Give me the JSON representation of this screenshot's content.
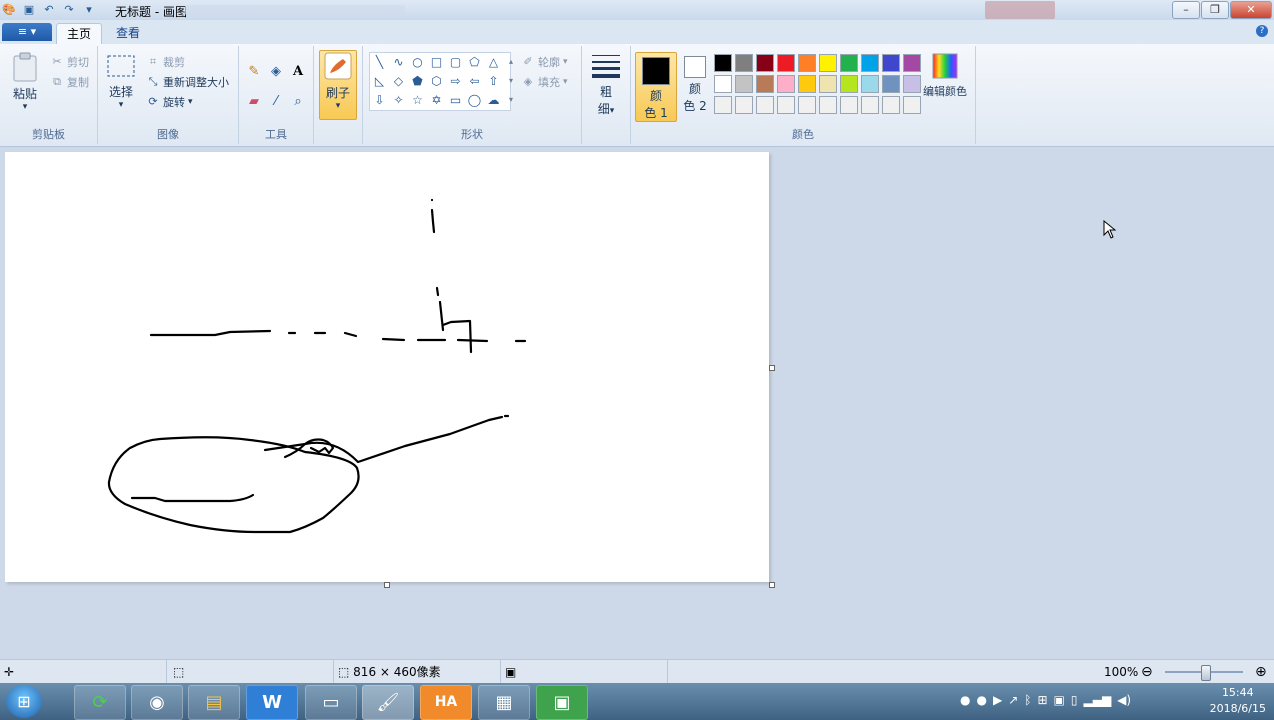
{
  "window": {
    "title": "无标题 - 画图",
    "min": "–",
    "max": "❐",
    "close": "✕"
  },
  "tabs": [
    {
      "label": "主页"
    },
    {
      "label": "查看"
    }
  ],
  "app_menu": "≡ ▾",
  "help": "?",
  "ribbon": {
    "clipboard": {
      "paste": "粘贴",
      "cut": "剪切",
      "copy": "复制",
      "label": "剪贴板"
    },
    "image": {
      "select": "选择",
      "crop": "裁剪",
      "resize": "重新调整大小",
      "rotate": "旋转",
      "label": "图像"
    },
    "tools": {
      "label": "工具",
      "text_tool": "A"
    },
    "brush": {
      "label": "刷子"
    },
    "shapes": {
      "outline": "轮廓",
      "fill": "填充",
      "label": "形状"
    },
    "size": {
      "label_line1": "粗",
      "label_line2": "细"
    },
    "colors": {
      "color1_a": "颜",
      "color1_b": "色 1",
      "color2_a": "颜",
      "color2_b": "色 2",
      "edit": "编辑颜色",
      "label": "颜色",
      "color1_value": "#000000",
      "color2_value": "#ffffff",
      "palette": [
        "#000000",
        "#7f7f7f",
        "#880015",
        "#ed1c24",
        "#ff7f27",
        "#fff200",
        "#22b14c",
        "#00a2e8",
        "#3f48cc",
        "#a349a4",
        "#ffffff",
        "#c3c3c3",
        "#b97a57",
        "#ffaec9",
        "#ffc90e",
        "#efe4b0",
        "#b5e61d",
        "#99d9ea",
        "#7092be",
        "#c8bfe7",
        "#f0f0f0",
        "#f0f0f0",
        "#f0f0f0",
        "#f0f0f0",
        "#f0f0f0",
        "#f0f0f0",
        "#f0f0f0",
        "#f0f0f0",
        "#f0f0f0",
        "#f0f0f0"
      ]
    }
  },
  "status": {
    "canvas_size": "816 × 460像素",
    "zoom": "100%",
    "zoom_minus": "⊖",
    "zoom_plus": "⊕"
  },
  "taskbar": {
    "time": "15:44",
    "date": "2018/6/15"
  }
}
